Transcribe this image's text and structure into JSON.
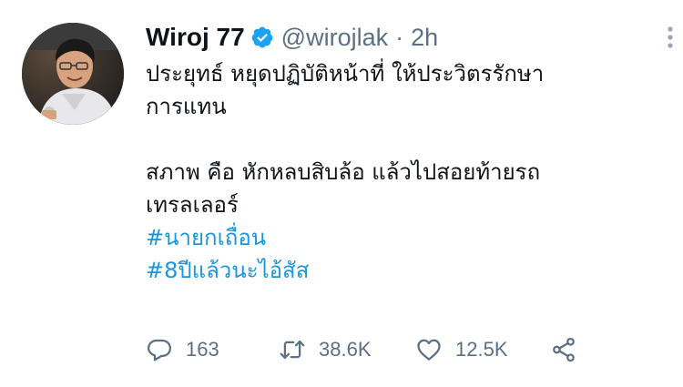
{
  "tweet": {
    "author": {
      "display_name": "Wiroj 77",
      "handle": "@wirojlak",
      "verified": true,
      "avatar_icon": "profile-photo"
    },
    "separator": "·",
    "time": "2h",
    "lines": [
      "ประยุทธ์ หยุดปฏิบัติหน้าที่ ให้ประวิตรรักษา",
      "การแทน",
      "สภาพ คือ หักหลบสิบล้อ แล้วไปสอยท้ายรถ",
      "เทรลเลอร์"
    ],
    "hashtags": [
      "#นายกเถื่อน",
      "#8ปีแล้วนะไอ้สัส"
    ],
    "actions": {
      "reply_count": "163",
      "retweet_count": "38.6K",
      "like_count": "12.5K"
    }
  },
  "colors": {
    "text": "#0f1419",
    "secondary": "#5b7083",
    "link": "#1b95e0",
    "verified": "#1da1f2"
  }
}
